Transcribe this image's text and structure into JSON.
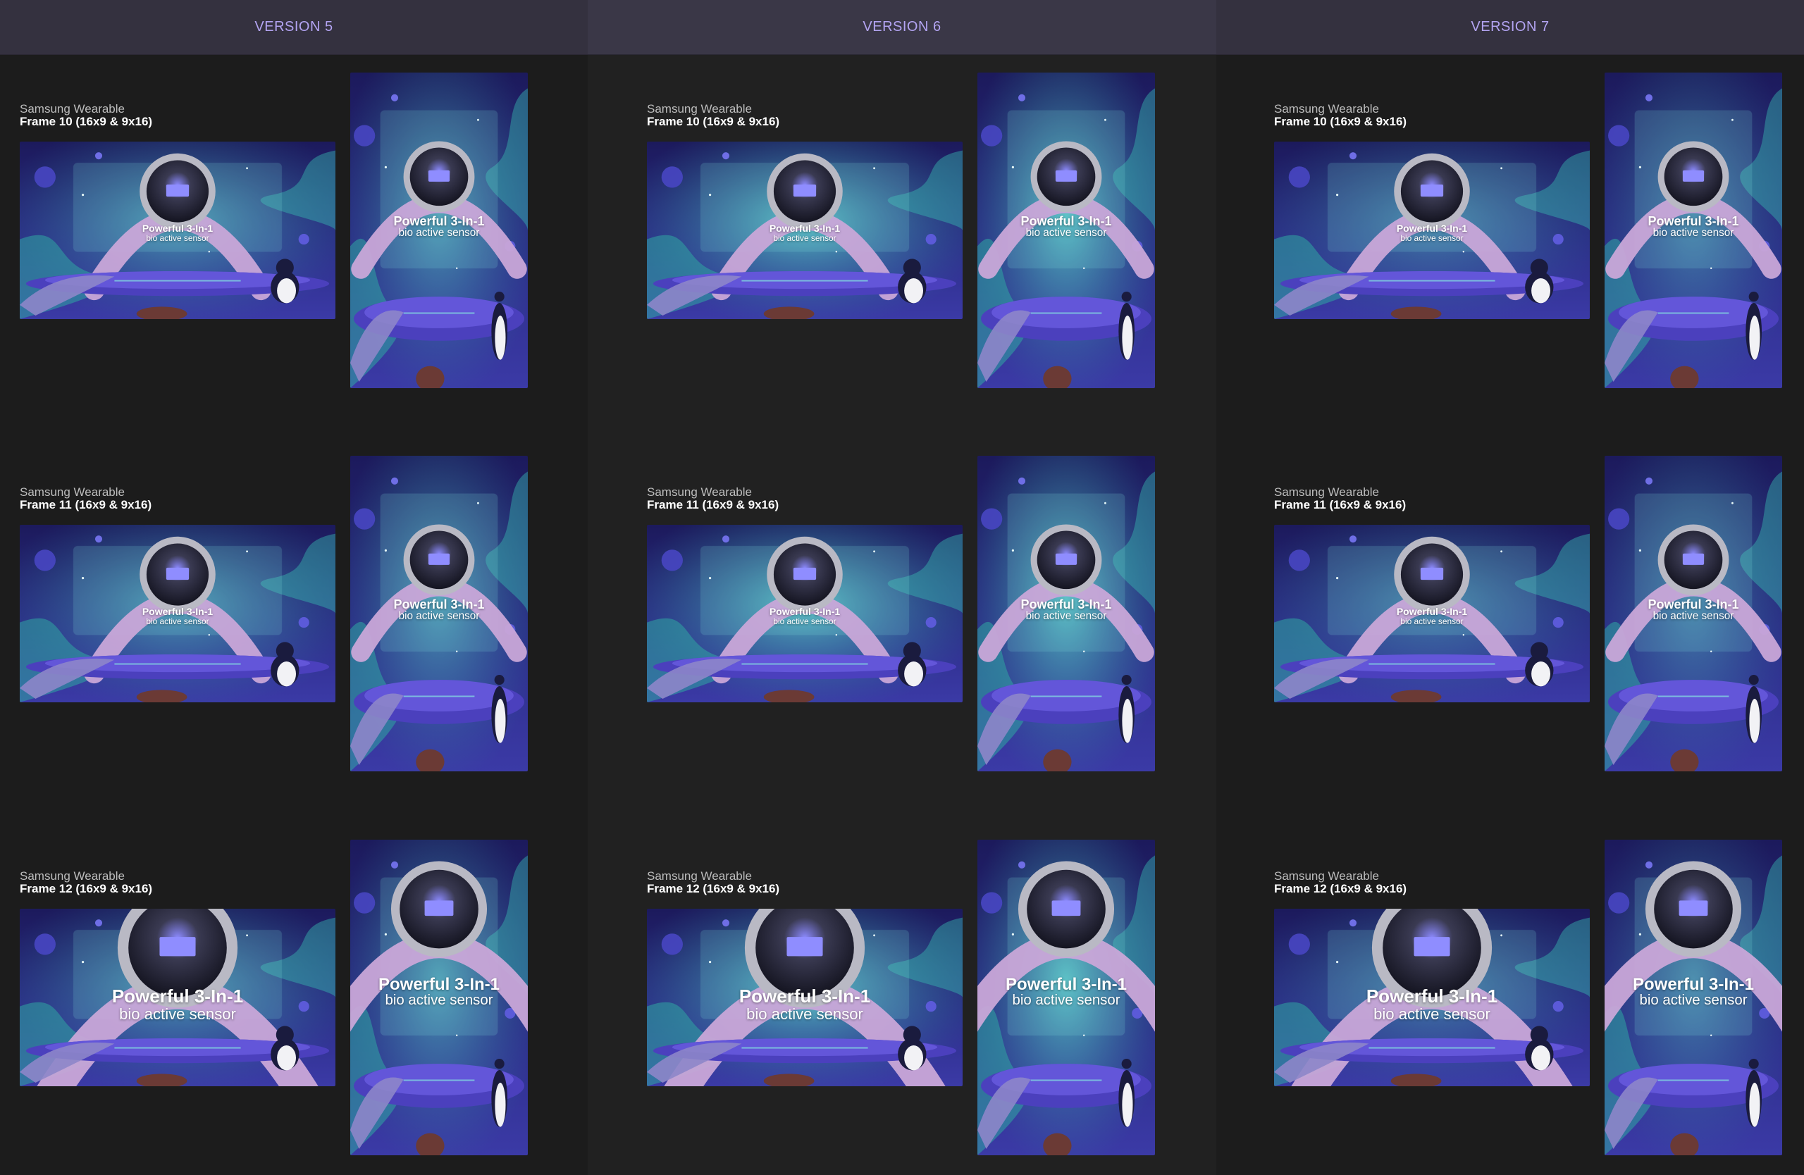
{
  "columns": [
    {
      "title": "VERSION 5"
    },
    {
      "title": "VERSION 6"
    },
    {
      "title": "VERSION 7"
    }
  ],
  "rows": [
    {
      "brand": "Samsung Wearable",
      "frame": "Frame 10 (16x9 & 9x16)"
    },
    {
      "brand": "Samsung Wearable",
      "frame": "Frame 11 (16x9 & 9x16)"
    },
    {
      "brand": "Samsung Wearable",
      "frame": "Frame 12 (16x9 & 9x16)"
    }
  ],
  "creative": {
    "headline_line1": "Powerful 3-In-1",
    "headline_line2": "bio active sensor"
  },
  "colors": {
    "header_text": "#b3a4f2",
    "space_deep": "#1c1a5c",
    "space_mid": "#2d2e8f",
    "teal": "#3fb6b4",
    "strap": "#c9a6d8",
    "podium": "#5a4fcf"
  }
}
